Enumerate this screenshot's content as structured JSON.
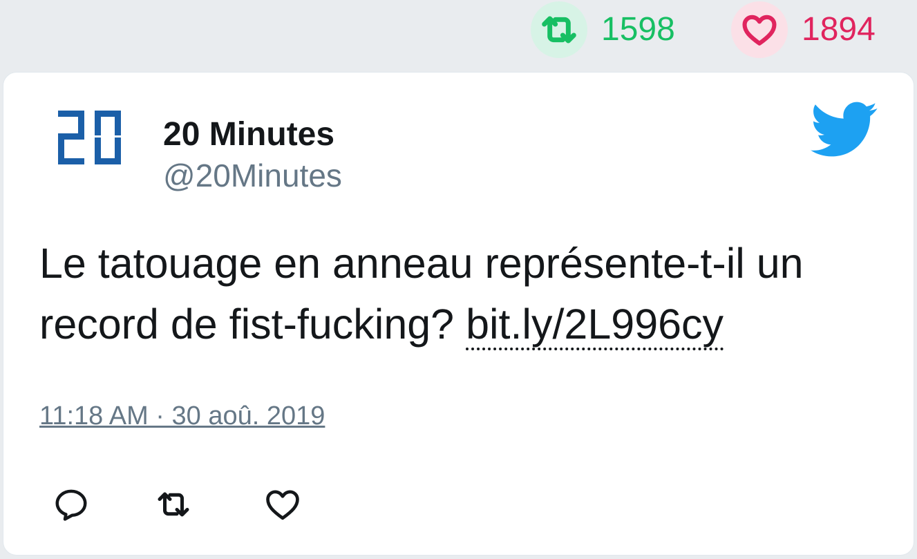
{
  "stats": {
    "retweet_count": "1598",
    "like_count": "1894",
    "retweet_icon": "retweet-icon",
    "like_icon": "heart-icon"
  },
  "tweet": {
    "author_name": "20 Minutes",
    "author_handle": "@20Minutes",
    "avatar_icon": "20-minutes-logo",
    "text": "Le tatouage en anneau représente-t-il un record de fist-fucking? ",
    "link_text": "bit.ly/2L996cy",
    "timestamp": "11:18 AM · 30 aoû. 2019",
    "brand_icon": "twitter-bird-icon"
  },
  "actions": {
    "reply_icon": "reply-icon",
    "retweet_icon": "retweet-icon",
    "like_icon": "heart-icon"
  },
  "colors": {
    "retweet_green": "#17bf63",
    "like_red": "#e0245e",
    "twitter_blue": "#1da1f2",
    "text_primary": "#14171a",
    "text_secondary": "#657786",
    "background": "#e9ecef",
    "logo_blue": "#1b5fa8"
  }
}
